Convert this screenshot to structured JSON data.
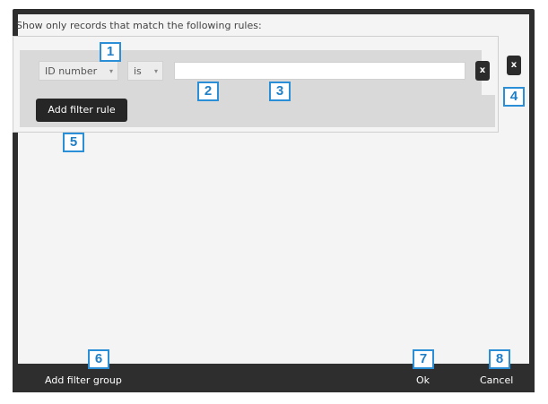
{
  "dialog": {
    "intro_text": "Show only records that match the following rules:",
    "rule": {
      "field_value": "ID number",
      "operator_value": "is",
      "text_value": ""
    },
    "remove_rule_label": "x",
    "remove_group_label": "x",
    "add_rule_label": "Add filter rule"
  },
  "footer": {
    "add_group_label": "Add filter group",
    "ok_label": "Ok",
    "cancel_label": "Cancel"
  },
  "callouts": [
    "1",
    "2",
    "3",
    "4",
    "5",
    "6",
    "7",
    "8"
  ]
}
